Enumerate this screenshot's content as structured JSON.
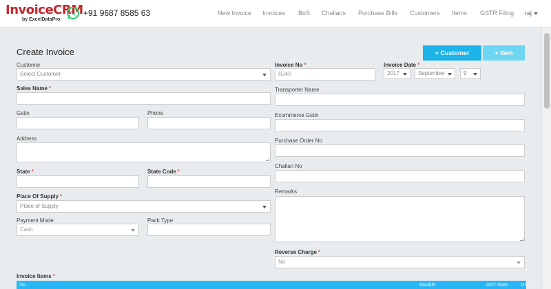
{
  "header": {
    "logo_text": "InvoiceCRM",
    "logo_sub": "by ExcelDataPro",
    "phone": "+91 9687 8585 63",
    "nav": [
      "New Invoice",
      "Invoices",
      "BoS",
      "Challans",
      "Purchase Bills",
      "Customers",
      "Items",
      "GSTR Filing"
    ],
    "user": "raj"
  },
  "page": {
    "title": "Create Invoice",
    "btn_customer": "+ Customer",
    "btn_item": "+ Item"
  },
  "form": {
    "customer_label": "Customer",
    "customer_placeholder": "Select Customer",
    "sales_name_label": "Sales Name",
    "gstin_label": "Gstin",
    "phone_label": "Phone",
    "address_label": "Address",
    "state_label": "State",
    "state_code_label": "State Code",
    "place_of_supply_label": "Place Of Supply",
    "place_of_supply_placeholder": "Place of Supply",
    "payment_mode_label": "Payment Mode",
    "payment_mode_value": "Cash",
    "pack_type_label": "Pack Type",
    "invoice_no_label": "Invoice No",
    "invoice_no_value": "RJ40",
    "invoice_date_label": "Invoice Date",
    "date_year": "2017",
    "date_month": "September",
    "date_day": "9",
    "transporter_label": "Transporter Name",
    "ecommerce_label": "Ecommerce Gstin",
    "po_label": "Purchase Order No",
    "challan_label": "Challan No",
    "remarks_label": "Remarks",
    "reverse_charge_label": "Reverse Charge",
    "reverse_charge_value": "No",
    "required_mark": "*"
  },
  "items": {
    "label": "Invoice Items",
    "columns": [
      "No",
      "Taxable",
      "GST Rate",
      "GST Am"
    ]
  },
  "colors": {
    "accent": "#1cb3e8",
    "accent_light": "#6dd6f2",
    "brand_red": "#c1272d",
    "whatsapp": "#25d366"
  }
}
